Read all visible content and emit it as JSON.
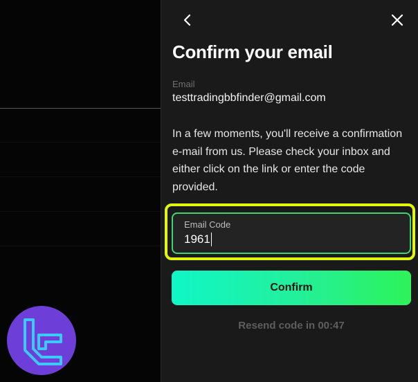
{
  "panel": {
    "title": "Confirm your email",
    "email_label": "Email",
    "email_value": "testtradingbbfinder@gmail.com",
    "info_text": "In a few moments, you'll receive a confirmation e-mail from us. Please check your inbox and either click on the link or enter the code provided.",
    "code_field": {
      "label": "Email Code",
      "value": "1961"
    },
    "confirm_label": "Confirm",
    "resend_text": "Resend code in 00:47",
    "icons": {
      "back": "chevron-left-icon",
      "close": "close-icon"
    }
  },
  "overlay": {
    "logo": "tradingfinder-logo"
  },
  "colors": {
    "accent_gradient_start": "#11f6c6",
    "accent_gradient_end": "#2ef25a",
    "highlight": "#e2f70f",
    "field_focus": "#3fd66e",
    "logo_bg": "#6d3fd8"
  }
}
